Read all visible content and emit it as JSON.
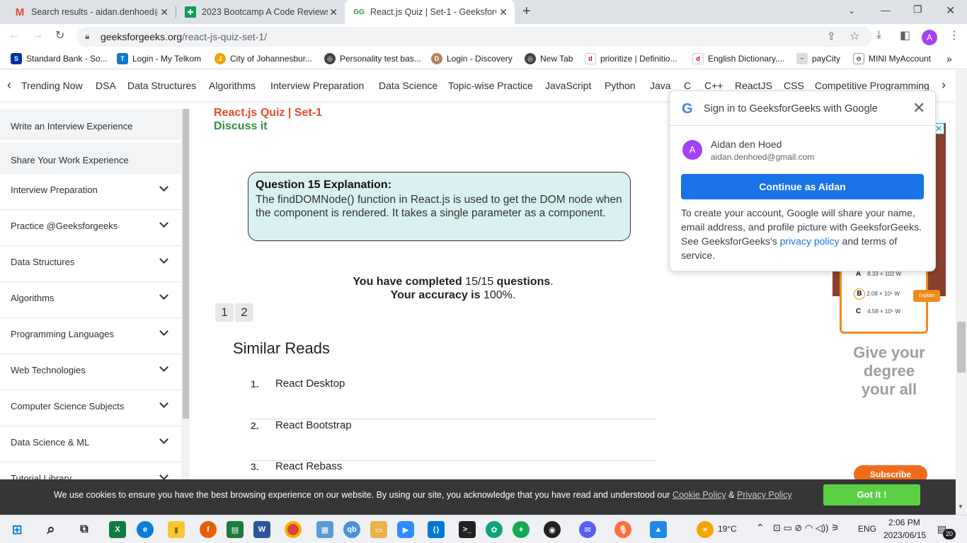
{
  "browser": {
    "tabs": [
      {
        "title": "Search results - aidan.denhoed@",
        "icon": "gmail-icon"
      },
      {
        "title": "2023 Bootcamp A Code Reviews",
        "icon": "sheets-icon"
      },
      {
        "title": "React.js Quiz | Set-1 - GeeksforGe",
        "icon": "gfg-icon",
        "active": true
      }
    ],
    "new_tab": "+",
    "url_domain": "geeksforgeeks.org",
    "url_path": "/react-js-quiz-set-1/",
    "profile_initial": "A",
    "bookmarks": [
      "Standard Bank - So...",
      "Login - My Telkom",
      "City of Johannesbur...",
      "Personality test bas...",
      "Login - Discovery",
      "New Tab",
      "prioritize | Definitio...",
      "English Dictionary,...",
      "payCity",
      "MINI MyAccount"
    ]
  },
  "site_nav": {
    "items": [
      "Trending Now",
      "DSA",
      "Data Structures",
      "Algorithms",
      "Interview Preparation",
      "Data Science",
      "Topic-wise Practice",
      "JavaScript",
      "Python",
      "Java",
      "C",
      "C++",
      "ReactJS",
      "CSS",
      "Competitive Programming"
    ]
  },
  "sidebar": {
    "top_items": [
      "Write an Interview Experience",
      "Share Your Work Experience"
    ],
    "items": [
      "Interview Preparation",
      "Practice @Geeksforgeeks",
      "Data Structures",
      "Algorithms",
      "Programming Languages",
      "Web Technologies",
      "Computer Science Subjects",
      "Data Science & ML",
      "Tutorial Library"
    ]
  },
  "main": {
    "quiz_title": "React.js Quiz | Set-1",
    "discuss": "Discuss it",
    "explanation_title": "Question 15 Explanation:",
    "explanation_text": "The findDOMNode() function in React.js is used to get the DOM node when the component is rendered. It takes a single parameter as a component.",
    "completed_prefix": "You have completed",
    "completed_value": "15/15",
    "completed_suffix": "questions",
    "accuracy_prefix": "Your accuracy is",
    "accuracy_value": "100%",
    "pages": [
      "1",
      "2"
    ],
    "similar_heading": "Similar Reads",
    "similar_reads": [
      {
        "num": "1.",
        "title": "React Desktop"
      },
      {
        "num": "2.",
        "title": "React Bootstrap"
      },
      {
        "num": "3.",
        "title": "React Rebass"
      }
    ]
  },
  "ad": {
    "options": [
      {
        "letter": "A",
        "value": "8.33 × 102 W"
      },
      {
        "letter": "B",
        "value": "2.08 × 10⁵ W"
      },
      {
        "letter": "C",
        "value": "4.58 × 10⁵ W"
      }
    ],
    "explain": "Explain",
    "headline": "Give your degree your all",
    "subscribe": "Subscribe"
  },
  "google_popup": {
    "title": "Sign in to GeeksforGeeks with Google",
    "avatar": "A",
    "name": "Aidan den Hoed",
    "email": "aidan.denhoed@gmail.com",
    "button": "Continue as Aidan",
    "text_before": "To create your account, Google will share your name, email address, and profile picture with GeeksforGeeks. See GeeksforGeeks's",
    "privacy_link": "privacy policy",
    "text_after": "and terms of service."
  },
  "cookie": {
    "text": "We use cookies to ensure you have the best browsing experience on our website. By using our site, you acknowledge that you have read and understood our",
    "cookie_policy": "Cookie Policy",
    "amp": "&",
    "privacy_policy": "Privacy Policy",
    "button": "Got It !"
  },
  "taskbar": {
    "temperature": "19°C",
    "language": "ENG",
    "time": "2:06 PM",
    "date": "2023/06/15",
    "notifications": "20"
  },
  "colors": {
    "accent_green": "#2f8d46",
    "quiz_title_red": "#e34c26",
    "google_blue": "#1a73e8",
    "cookie_button": "#5bd046"
  }
}
